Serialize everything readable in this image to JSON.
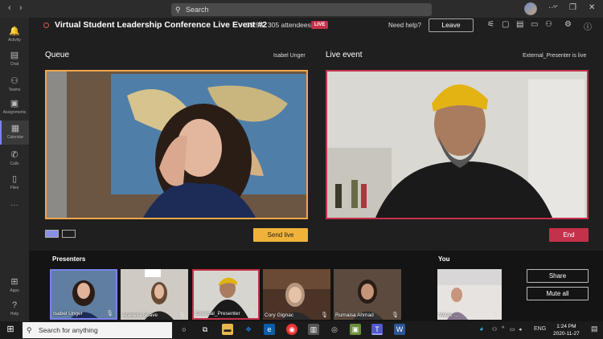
{
  "titlebar": {
    "search_placeholder": "Search",
    "back": "‹",
    "forward": "›",
    "more": "···",
    "minimize": "–",
    "maximize": "❐",
    "close": "✕"
  },
  "rail": {
    "items": [
      {
        "label": "Activity",
        "icon": "bell-icon"
      },
      {
        "label": "Chat",
        "icon": "chat-icon"
      },
      {
        "label": "Teams",
        "icon": "teams-icon"
      },
      {
        "label": "Assignments",
        "icon": "assignments-icon"
      },
      {
        "label": "Calendar",
        "icon": "calendar-icon"
      },
      {
        "label": "Calls",
        "icon": "phone-icon"
      },
      {
        "label": "Files",
        "icon": "file-icon"
      },
      {
        "label": "···",
        "icon": "more-icon"
      },
      {
        "label": "Apps",
        "icon": "apps-icon"
      },
      {
        "label": "Help",
        "icon": "help-icon"
      }
    ]
  },
  "event": {
    "title": "Virtual Student Leadership Conference Live Event #2",
    "elapsed": "35:53",
    "attendees": "305 attendees",
    "live_badge": "LIVE",
    "need_help": "Need help?",
    "leave_label": "Leave"
  },
  "queue": {
    "label": "Queue",
    "presenter": "Isabel Unger",
    "send_live_label": "Send live"
  },
  "live": {
    "label": "Live event",
    "status": "External_Presenter is live",
    "end_label": "End"
  },
  "presenters": {
    "label": "Presenters",
    "tiles": [
      {
        "name": "Isabel Unger",
        "state": "selected"
      },
      {
        "name": "Arabella Soave",
        "state": "normal"
      },
      {
        "name": "External_Presenter",
        "state": "live"
      },
      {
        "name": "Cory Gignac",
        "state": "normal"
      },
      {
        "name": "Rumaisa Ahmad",
        "state": "normal"
      }
    ]
  },
  "you": {
    "label": "You",
    "name": "Wade ...",
    "share_label": "Share",
    "mute_all_label": "Mute all"
  },
  "taskbar": {
    "search_placeholder": "Search for anything",
    "lang": "ENG",
    "time": "1:24 PM",
    "date": "2020-11-27"
  },
  "colors": {
    "accent": "#7b83eb",
    "live_red": "#c4314b",
    "queue_orange": "#f0a64a",
    "send_live_yellow": "#f0b33a"
  }
}
